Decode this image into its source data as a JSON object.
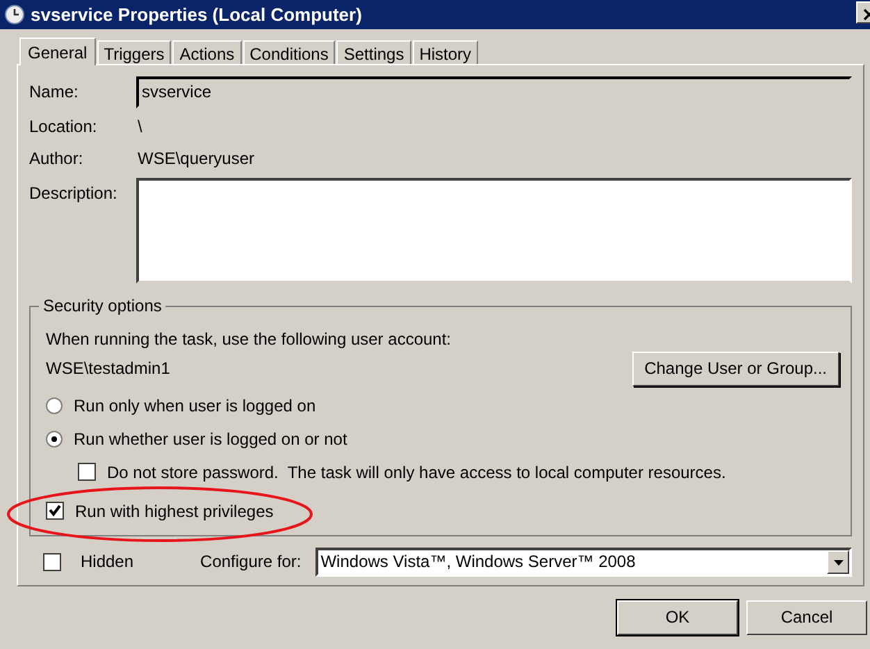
{
  "window": {
    "title": "svservice Properties (Local Computer)"
  },
  "tabs": [
    {
      "label": "General",
      "selected": true
    },
    {
      "label": "Triggers",
      "selected": false
    },
    {
      "label": "Actions",
      "selected": false
    },
    {
      "label": "Conditions",
      "selected": false
    },
    {
      "label": "Settings",
      "selected": false
    },
    {
      "label": "History",
      "selected": false
    }
  ],
  "fields": [
    {
      "kind": "text",
      "label": "Name:",
      "value": "svservice"
    },
    {
      "kind": "static",
      "label": "Location:",
      "value": "\\"
    },
    {
      "kind": "static",
      "label": "Author:",
      "value": "WSE\\queryuser"
    },
    {
      "kind": "textarea",
      "label": "Description:"
    }
  ],
  "security": {
    "title": "Security options",
    "prompt": "When running the task, use the following user account:",
    "account": "WSE\\testadmin1",
    "change_button": "Change User or Group...",
    "options": [
      {
        "kind": "radio",
        "label": "Run only when user is logged on",
        "selected": false
      },
      {
        "kind": "radio",
        "label": "Run whether user is logged on or not",
        "selected": true,
        "children": [
          {
            "kind": "checkbox",
            "label": "Do not store password.  The task will only have access to local computer resources.",
            "checked": false
          }
        ]
      },
      {
        "kind": "checkbox",
        "label": "Run with highest privileges",
        "checked": true
      }
    ]
  },
  "hidden": {
    "label": "Hidden",
    "checked": false
  },
  "configure": {
    "label": "Configure for:",
    "value": "Windows Vista™, Windows Server™ 2008"
  },
  "buttons": [
    "OK",
    "Cancel"
  ]
}
